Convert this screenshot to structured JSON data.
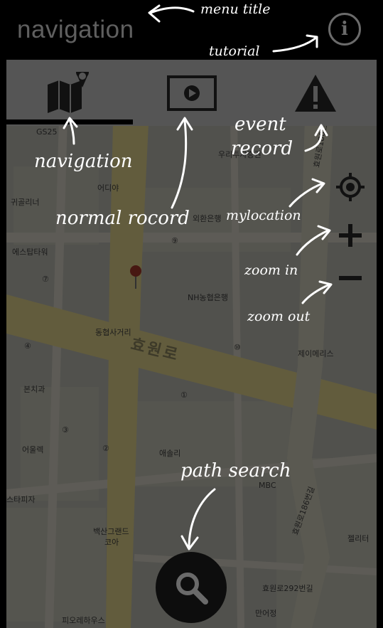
{
  "action_bar": {
    "title": "navigation",
    "info_icon": "info-icon"
  },
  "tabs": [
    {
      "name": "navigation",
      "icon": "map-pin-icon",
      "selected": true
    },
    {
      "name": "normal record",
      "icon": "video-play-icon",
      "selected": false
    },
    {
      "name": "event record",
      "icon": "warning-icon",
      "selected": false
    }
  ],
  "controls": {
    "mylocation_icon": "crosshair-icon",
    "zoom_in_icon": "plus-icon",
    "zoom_out_icon": "minus-icon"
  },
  "fab": {
    "icon": "search-icon"
  },
  "map": {
    "labels": [
      "GS25",
      "우리투자증권",
      "어디야",
      "외환은행",
      "귀골리너",
      "에스탑타워",
      "NH농협은행",
      "동협사거리",
      "효원로",
      "제이메리스",
      "본치과",
      "어울렉",
      "애솔리",
      "MBC",
      "스타피자",
      "백산그랜드",
      "코아",
      "효원로292번길",
      "만어정",
      "피오레하우스",
      "젤리터",
      "효원로180번길",
      "효원로186번길"
    ],
    "road_text": "효원로"
  },
  "annotations": {
    "menu_title": "menu title",
    "tutorial": "tutorial",
    "navigation": "navigation",
    "normal_record": "normal rocord",
    "event_record_line1": "event",
    "event_record_line2": "record",
    "mylocation": "mylocation",
    "zoom_in": "zoom in",
    "zoom_out": "zoom out",
    "path_search": "path search"
  },
  "colors": {
    "action_bar_bg": "#000000",
    "title_color": "#5f5f5f",
    "tab_bar_bg": "#555555",
    "icon_color": "#111111",
    "fab_bg": "#0d0d0d",
    "annotation_color": "#ffffff"
  }
}
